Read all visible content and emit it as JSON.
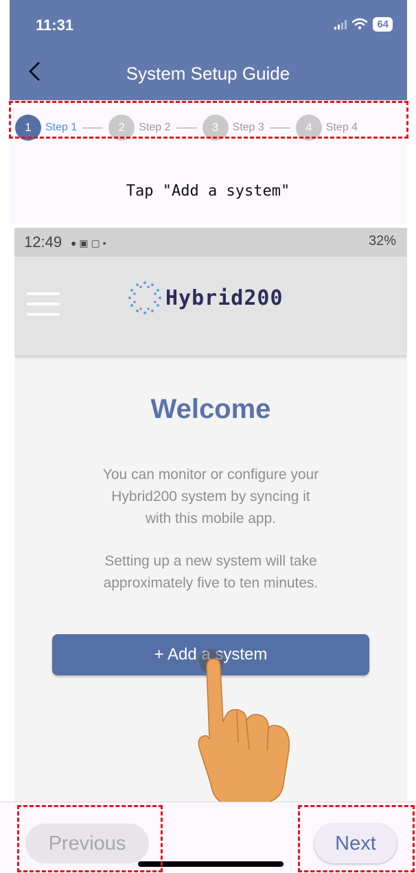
{
  "status_bar": {
    "time": "11:31",
    "battery": "64"
  },
  "header": {
    "title": "System Setup Guide",
    "back_icon": "chevron-left-icon"
  },
  "stepper": {
    "steps": [
      {
        "number": "1",
        "label": "Step 1",
        "active": true
      },
      {
        "number": "2",
        "label": "Step 2",
        "active": false
      },
      {
        "number": "3",
        "label": "Step 3",
        "active": false
      },
      {
        "number": "4",
        "label": "Step 4",
        "active": false
      }
    ]
  },
  "instruction": "Tap \"Add a system\"",
  "screenshot": {
    "status_time": "12:49",
    "status_right": "32%",
    "app_name": "Hybrid200",
    "welcome": "Welcome",
    "paragraph1": [
      "You can monitor or configure your",
      "Hybrid200 system by syncing it",
      "with this mobile app."
    ],
    "paragraph2": [
      "Setting up a new system will take",
      "approximately five to ten minutes."
    ],
    "add_button": "+ Add a system"
  },
  "nav": {
    "previous": "Previous",
    "next": "Next"
  },
  "colors": {
    "header_bg": "#6279AD",
    "accent": "#5570a5",
    "highlight": "#e8121c",
    "step_active_text": "#4a90e2"
  }
}
